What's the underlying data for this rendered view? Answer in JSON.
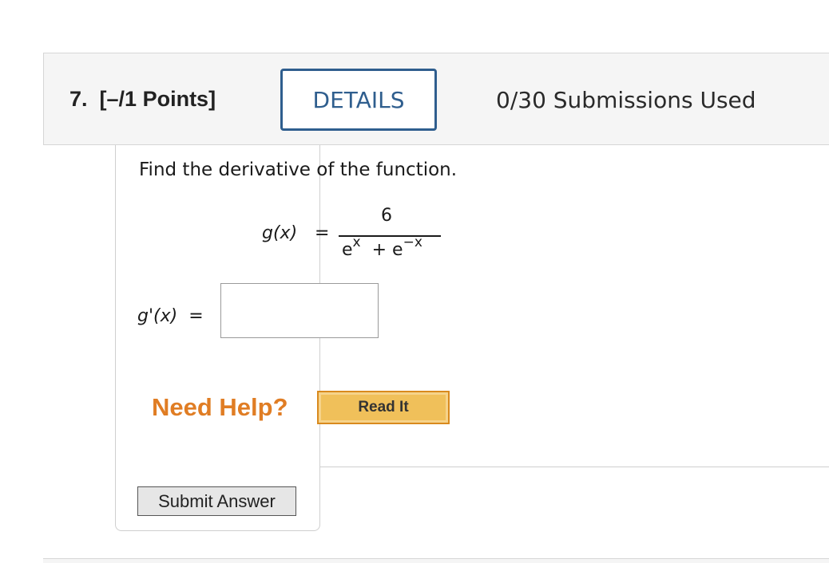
{
  "question": {
    "number_label": "7.",
    "points_label": "[–/1 Points]",
    "details_label": "DETAILS",
    "submissions_label": "0/30 Submissions Used"
  },
  "problem": {
    "prompt": "Find the derivative of the function.",
    "function_lhs": "g(x)",
    "equals": "=",
    "numerator": "6",
    "denominator_base1": "e",
    "denominator_exp1": "x",
    "denominator_plus": "+",
    "denominator_base2": "e",
    "denominator_exp2": "−x",
    "answer_label": "g'(x)",
    "answer_equals": "=",
    "answer_value": ""
  },
  "help": {
    "need_help_label": "Need Help?",
    "read_it_label": "Read It"
  },
  "actions": {
    "submit_label": "Submit Answer"
  },
  "colors": {
    "details_border": "#2f5e8e",
    "need_help_text": "#e07d24",
    "read_it_fill": "#f0c05a",
    "header_bg": "#f5f5f5"
  }
}
